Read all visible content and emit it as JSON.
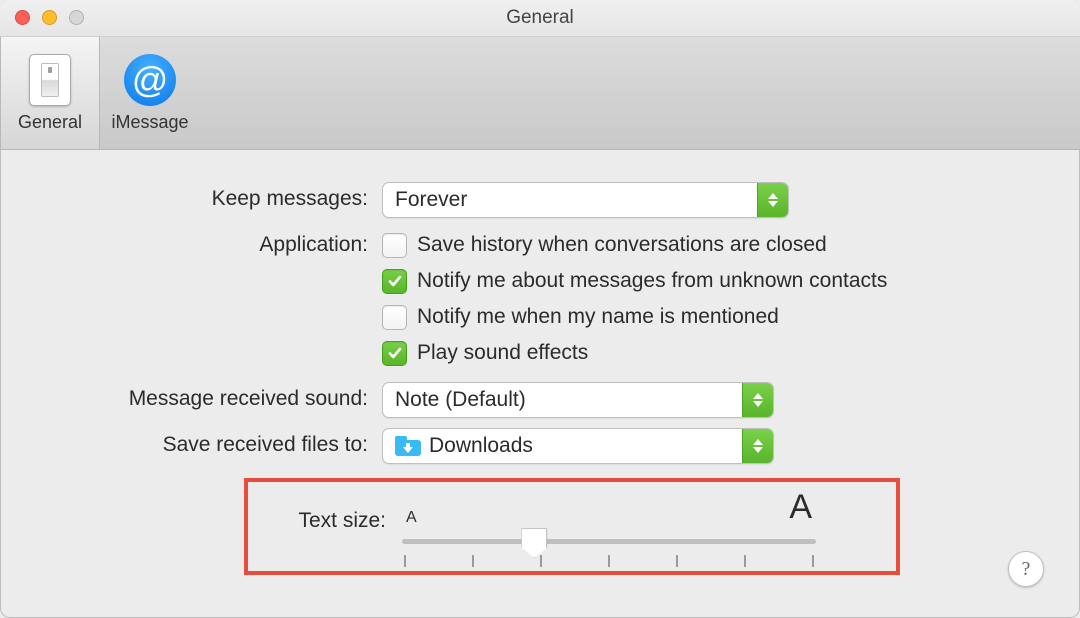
{
  "window": {
    "title": "General"
  },
  "tabs": {
    "general": {
      "label": "General"
    },
    "imessage": {
      "label": "iMessage",
      "glyph": "@"
    }
  },
  "form": {
    "keep_messages": {
      "label": "Keep messages:",
      "value": "Forever"
    },
    "application": {
      "label": "Application:",
      "items": [
        {
          "label": "Save history when conversations are closed",
          "checked": false
        },
        {
          "label": "Notify me about messages from unknown contacts",
          "checked": true
        },
        {
          "label": "Notify me when my name is mentioned",
          "checked": false
        },
        {
          "label": "Play sound effects",
          "checked": true
        }
      ]
    },
    "sound": {
      "label": "Message received sound:",
      "value": "Note (Default)"
    },
    "save_to": {
      "label": "Save received files to:",
      "value": "Downloads"
    },
    "text_size": {
      "label": "Text size:",
      "small_glyph": "A",
      "large_glyph": "A"
    }
  },
  "help": {
    "glyph": "?"
  }
}
